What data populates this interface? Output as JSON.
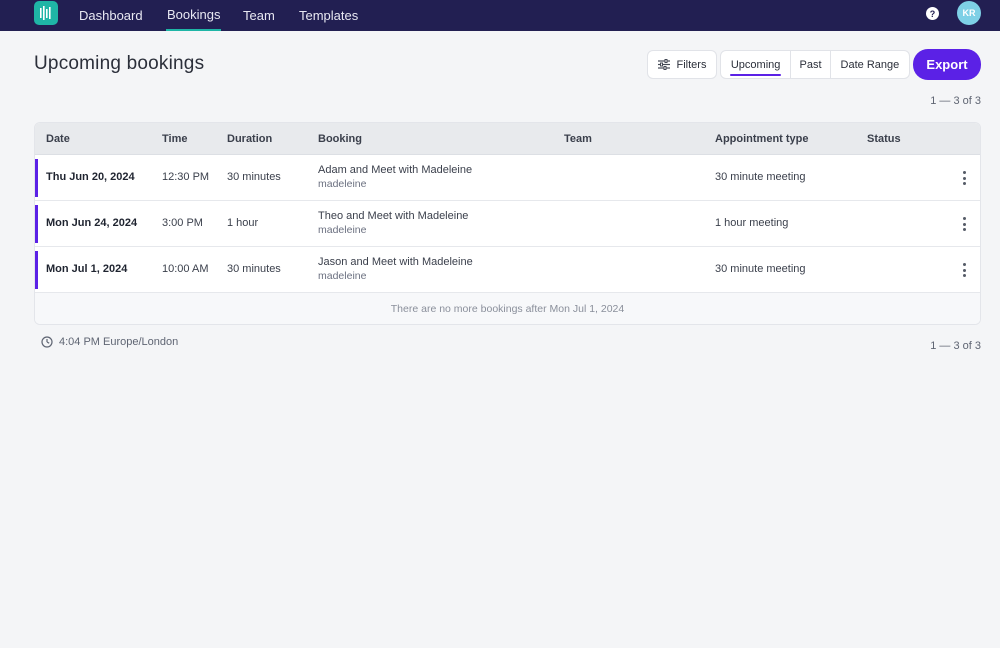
{
  "nav": {
    "items": [
      {
        "label": "Dashboard"
      },
      {
        "label": "Bookings"
      },
      {
        "label": "Team"
      },
      {
        "label": "Templates"
      }
    ],
    "active": "Bookings",
    "help_glyph": "?",
    "avatar_initials": "KR",
    "brand_color": "#221f52",
    "accent_color": "#1fb5a6"
  },
  "header": {
    "title": "Upcoming bookings",
    "filters_label": "Filters",
    "segments": [
      {
        "label": "Upcoming"
      },
      {
        "label": "Past"
      },
      {
        "label": "Date Range"
      }
    ],
    "active_segment": "Upcoming",
    "export_label": "Export",
    "primary_color": "#5b21e6"
  },
  "pagination": {
    "top": "1 — 3 of 3",
    "bottom": "1 — 3 of 3"
  },
  "table": {
    "columns": [
      "Date",
      "Time",
      "Duration",
      "Booking",
      "Team",
      "Appointment type",
      "Status"
    ],
    "rows": [
      {
        "date": "Thu Jun 20, 2024",
        "time": "12:30 PM",
        "duration": "30 minutes",
        "booking_title": "Adam and Meet with Madeleine",
        "booking_sub": "madeleine",
        "team": "",
        "appointment_type": "30 minute meeting",
        "status": ""
      },
      {
        "date": "Mon Jun 24, 2024",
        "time": "3:00 PM",
        "duration": "1 hour",
        "booking_title": "Theo and Meet with Madeleine",
        "booking_sub": "madeleine",
        "team": "",
        "appointment_type": "1 hour meeting",
        "status": ""
      },
      {
        "date": "Mon Jul 1, 2024",
        "time": "10:00 AM",
        "duration": "30 minutes",
        "booking_title": "Jason and Meet with Madeleine",
        "booking_sub": "madeleine",
        "team": "",
        "appointment_type": "30 minute meeting",
        "status": ""
      }
    ],
    "empty_note": "There are no more bookings after Mon Jul 1, 2024"
  },
  "footer": {
    "timezone": "4:04 PM Europe/London",
    "icon": "clock-icon"
  }
}
